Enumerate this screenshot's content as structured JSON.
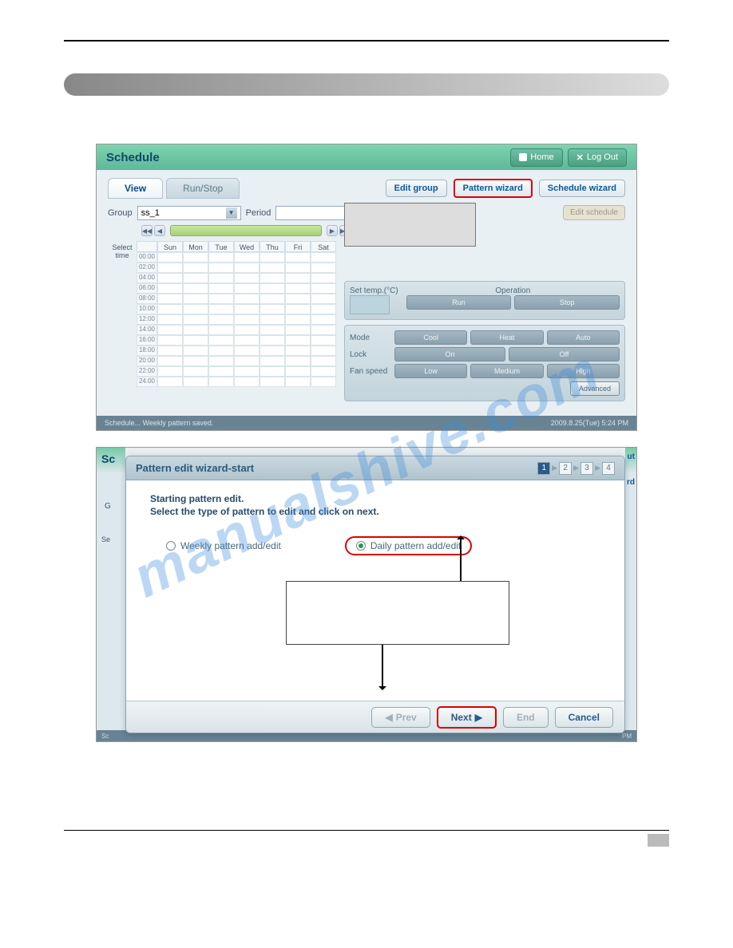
{
  "screenshot1": {
    "title": "Schedule",
    "home": "Home",
    "logout": "Log Out",
    "tabs": {
      "view": "View",
      "runstop": "Run/Stop"
    },
    "buttons": {
      "editgroup": "Edit group",
      "patternwizard": "Pattern wizard",
      "schedulewizard": "Schedule wizard",
      "editschedule": "Edit schedule"
    },
    "labels": {
      "group": "Group",
      "period": "Period",
      "selecttime": "Select time"
    },
    "group_value": "ss_1",
    "days": [
      "Sun",
      "Mon",
      "Tue",
      "Wed",
      "Thu",
      "Fri",
      "Sat"
    ],
    "times": [
      "00:00",
      "02:00",
      "04:00",
      "06:00",
      "08:00",
      "10:00",
      "12:00",
      "14:00",
      "16:00",
      "18:00",
      "20:00",
      "22:00",
      "24:00"
    ],
    "panel": {
      "settemp": "Set temp.(°C)",
      "operation": "Operation",
      "run": "Run",
      "stop": "Stop",
      "mode": "Mode",
      "cool": "Cool",
      "heat": "Heat",
      "auto": "Auto",
      "lock": "Lock",
      "on": "On",
      "off": "Off",
      "fanspeed": "Fan speed",
      "low": "Low",
      "medium": "Medium",
      "high": "High",
      "advanced": "Advanced"
    },
    "status": {
      "left": "Schedule...   Weekly pattern saved.",
      "right": "2009.8.25(Tue)  5:24 PM"
    }
  },
  "screenshot2": {
    "bg_title": "Sc",
    "bg_ut": "ut",
    "bg_rd": "rd",
    "bg_g": "G",
    "modal": {
      "title": "Pattern edit wizard-start",
      "steps": [
        "1",
        "2",
        "3",
        "4"
      ],
      "heading1": "Starting pattern edit.",
      "heading2": "Select the type of pattern to edit and click on next.",
      "opt_weekly": "Weekly pattern add/edit",
      "opt_daily": "Daily pattern add/edit",
      "btn_prev": "Prev",
      "btn_next": "Next",
      "btn_end": "End",
      "btn_cancel": "Cancel"
    },
    "bg_sel": "Se",
    "bg_footer_right": "PM"
  },
  "watermark": "manualshive.com"
}
